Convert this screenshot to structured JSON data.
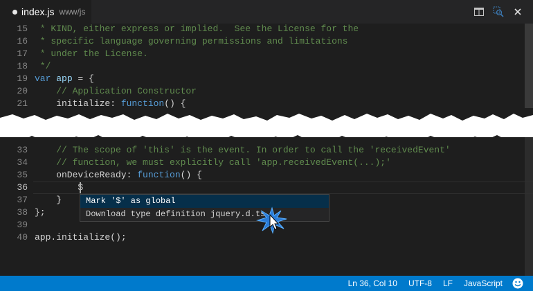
{
  "tab": {
    "filename": "index.js",
    "path": "www/js"
  },
  "icons": {
    "split": "split-editor-icon",
    "open_changes": "open-changes-icon",
    "close": "close-icon",
    "feedback": "smiley-feedback-icon",
    "cursor": "mouse-pointer-icon"
  },
  "colors": {
    "editor_bg": "#1e1e1e",
    "status_bg": "#007acc",
    "comment": "#608b4e",
    "keyword": "#569cd6",
    "suggest_selected": "#062f4a"
  },
  "lines_top": [
    {
      "n": "15",
      "t": " * KIND, either express or implied.  See the License for the"
    },
    {
      "n": "16",
      "t": " * specific language governing permissions and limitations"
    },
    {
      "n": "17",
      "t": " * under the License."
    },
    {
      "n": "18",
      "t": " */"
    },
    {
      "n": "19",
      "t": "var app = {"
    },
    {
      "n": "20",
      "t": "    // Application Constructor"
    },
    {
      "n": "21",
      "t": "    initialize: function() {"
    }
  ],
  "lines_bottom": [
    {
      "n": "33",
      "t": "    // The scope of 'this' is the event. In order to call the 'receivedEvent'"
    },
    {
      "n": "34",
      "t": "    // function, we must explicitly call 'app.receivedEvent(...);'"
    },
    {
      "n": "35",
      "t": "    onDeviceReady: function() {"
    },
    {
      "n": "36",
      "t": "        $"
    },
    {
      "n": "37",
      "t": "    }"
    },
    {
      "n": "38",
      "t": "};"
    },
    {
      "n": "39",
      "t": ""
    },
    {
      "n": "40",
      "t": "app.initialize();"
    }
  ],
  "suggestions": [
    {
      "label": "Mark '$' as global",
      "selected": true
    },
    {
      "label": "Download type definition jquery.d.ts",
      "selected": false
    }
  ],
  "status": {
    "position": "Ln 36, Col 10",
    "encoding": "UTF-8",
    "eol": "LF",
    "language": "JavaScript"
  }
}
